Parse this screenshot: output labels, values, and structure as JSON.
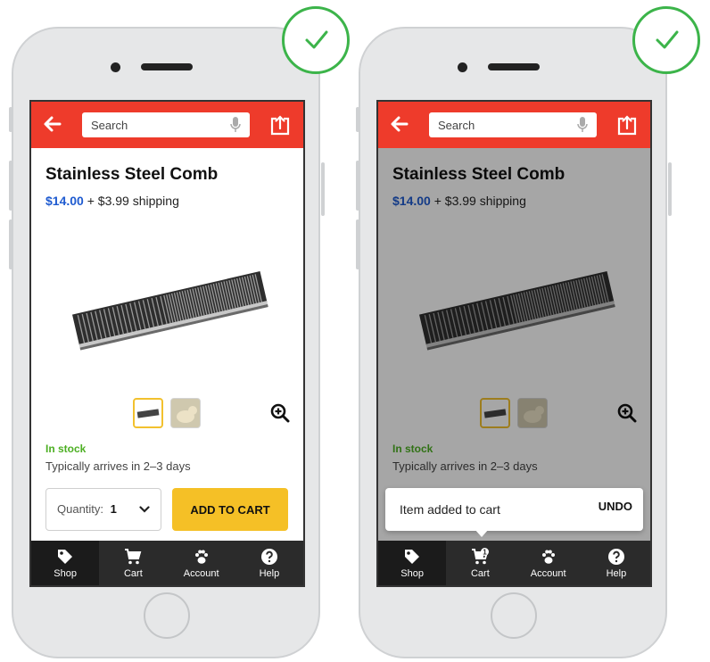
{
  "screens": [
    {
      "header": {
        "search_placeholder": "Search"
      },
      "product": {
        "title": "Stainless Steel Comb",
        "price": "$14.00",
        "shipping": " + $3.99 shipping",
        "stock_status": "In stock",
        "delivery_estimate": "Typically arrives in 2–3 days"
      },
      "quantity": {
        "label": "Quantity:",
        "value": "1"
      },
      "add_to_cart_label": "ADD TO CART",
      "tabs": [
        {
          "label": "Shop",
          "icon": "tag-icon",
          "active": true
        },
        {
          "label": "Cart",
          "icon": "cart-icon"
        },
        {
          "label": "Account",
          "icon": "paw-icon"
        },
        {
          "label": "Help",
          "icon": "help-icon"
        }
      ]
    },
    {
      "header": {
        "search_placeholder": "Search"
      },
      "product": {
        "title": "Stainless Steel Comb",
        "price": "$14.00",
        "shipping": " + $3.99 shipping",
        "stock_status": "In stock",
        "delivery_estimate": "Typically arrives in 2–3 days"
      },
      "snackbar": {
        "message": "Item added to cart",
        "action": "UNDO"
      },
      "cart_badge": "1",
      "tabs": [
        {
          "label": "Shop",
          "icon": "tag-icon",
          "active": true
        },
        {
          "label": "Cart",
          "icon": "cart-badge-icon"
        },
        {
          "label": "Account",
          "icon": "paw-icon"
        },
        {
          "label": "Help",
          "icon": "help-icon"
        }
      ]
    }
  ],
  "colors": {
    "header": "#ee3b2b",
    "price": "#1f5bd0",
    "in_stock": "#4caf22",
    "add_to_cart": "#f5c026",
    "tabbar": "#2b2b2b",
    "thumbnail_selected_border": "#f2c12e",
    "check_mark": "#3cb44a"
  },
  "approval_marks": [
    "check-icon",
    "check-icon"
  ]
}
